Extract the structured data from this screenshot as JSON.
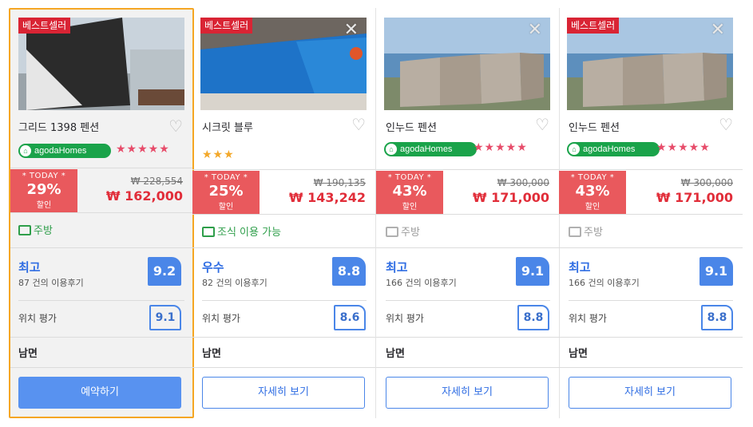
{
  "cards": [
    {
      "badge": "베스트셀러",
      "name": "그리드 1398 펜션",
      "agoda": "agodaHomes",
      "stars": "★★★★★",
      "today": "* TODAY *",
      "discount": "29%",
      "discount_label": "할인",
      "old_price": "₩ 228,554",
      "new_price": "₩ 162,000",
      "amenity": "주방",
      "rating_word": "최고",
      "review_count": "87 건의 이용후기",
      "score": "9.2",
      "location_label": "위치 평가",
      "location_score": "9.1",
      "area": "남면",
      "button": "예약하기"
    },
    {
      "badge": "베스트셀러",
      "name": "시크릿 블루",
      "stars": "★★★",
      "today": "* TODAY *",
      "discount": "25%",
      "discount_label": "할인",
      "old_price": "₩ 190,135",
      "new_price": "₩ 143,242",
      "amenity": "조식 이용 가능",
      "rating_word": "우수",
      "review_count": "82 건의 이용후기",
      "score": "8.8",
      "location_label": "위치 평가",
      "location_score": "8.6",
      "area": "남면",
      "button": "자세히 보기"
    },
    {
      "name": "인누드 펜션",
      "agoda": "agodaHomes",
      "stars": "★★★★★",
      "today": "* TODAY *",
      "discount": "43%",
      "discount_label": "할인",
      "old_price": "₩ 300,000",
      "new_price": "₩ 171,000",
      "amenity": "주방",
      "rating_word": "최고",
      "review_count": "166 건의 이용후기",
      "score": "9.1",
      "location_label": "위치 평가",
      "location_score": "8.8",
      "area": "남면",
      "button": "자세히 보기"
    },
    {
      "badge": "베스트셀러",
      "name": "인누드 펜션",
      "agoda": "agodaHomes",
      "stars": "★★★★★",
      "today": "* TODAY *",
      "discount": "43%",
      "discount_label": "할인",
      "old_price": "₩ 300,000",
      "new_price": "₩ 171,000",
      "amenity": "주방",
      "rating_word": "최고",
      "review_count": "166 건의 이용후기",
      "score": "9.1",
      "location_label": "위치 평가",
      "location_score": "8.8",
      "area": "남면",
      "button": "자세히 보기"
    }
  ],
  "icons": {
    "close": "close-icon",
    "heart": "heart-icon",
    "home": "home-icon"
  },
  "colors": {
    "badge": "#d92434",
    "today": "#e9595d",
    "price": "#e12d39",
    "score": "#4a86e8",
    "agoda": "#1aa34a",
    "selected_border": "#f5a623"
  }
}
